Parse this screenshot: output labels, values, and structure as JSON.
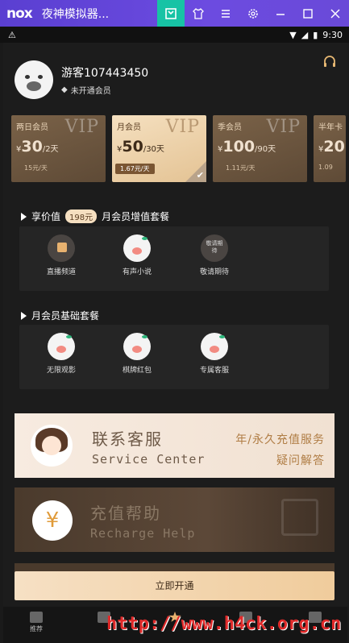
{
  "window": {
    "logo": "nox",
    "title": "夜神模拟器...",
    "controls": [
      "bookmark-icon",
      "shirt-icon",
      "menu-icon",
      "gear-icon",
      "minimize-icon",
      "maximize-icon",
      "close-icon"
    ]
  },
  "statusbar": {
    "time": "9:30"
  },
  "profile": {
    "name": "游客107443450",
    "vip_status": "未开通会员"
  },
  "plans": [
    {
      "name": "两日会员",
      "vip": "VIP",
      "currency": "¥",
      "price": "30",
      "unit": "/2天",
      "per_day": "15元/天",
      "selected": false
    },
    {
      "name": "月会员",
      "vip": "VIP",
      "currency": "¥",
      "price": "50",
      "unit": "/30天",
      "per_day": "1.67元/天",
      "selected": true
    },
    {
      "name": "季会员",
      "vip": "VIP",
      "currency": "¥",
      "price": "100",
      "unit": "/90天",
      "per_day": "1.11元/天",
      "selected": false
    },
    {
      "name": "半年卡",
      "vip": "",
      "currency": "¥",
      "price": "20",
      "unit": "",
      "per_day": "1.09",
      "selected": false
    }
  ],
  "section_value": {
    "prefix": "享价值",
    "badge": "198元",
    "suffix": "月会员增值套餐",
    "items": [
      {
        "label": "直播频道"
      },
      {
        "label": "有声小说"
      },
      {
        "label": "敬请期待",
        "icon_text": "敬请期待"
      }
    ]
  },
  "section_basic": {
    "title": "月会员基础套餐",
    "items": [
      {
        "label": "无限观影"
      },
      {
        "label": "棋牌红包"
      },
      {
        "label": "专属客服"
      }
    ]
  },
  "service_card": {
    "title": "联系客服",
    "subtitle": "Service Center",
    "right1": "年/永久充值服务",
    "right2": "疑问解答"
  },
  "recharge_card": {
    "icon": "¥",
    "title": "充值帮助",
    "subtitle": "Recharge Help"
  },
  "cta": {
    "label": "立即开通"
  },
  "bottom_nav": [
    {
      "label": "推荐"
    },
    {
      "label": ""
    },
    {
      "label": ""
    },
    {
      "label": ""
    },
    {
      "label": ""
    }
  ],
  "watermark": "http://www.h4ck.org.cn"
}
